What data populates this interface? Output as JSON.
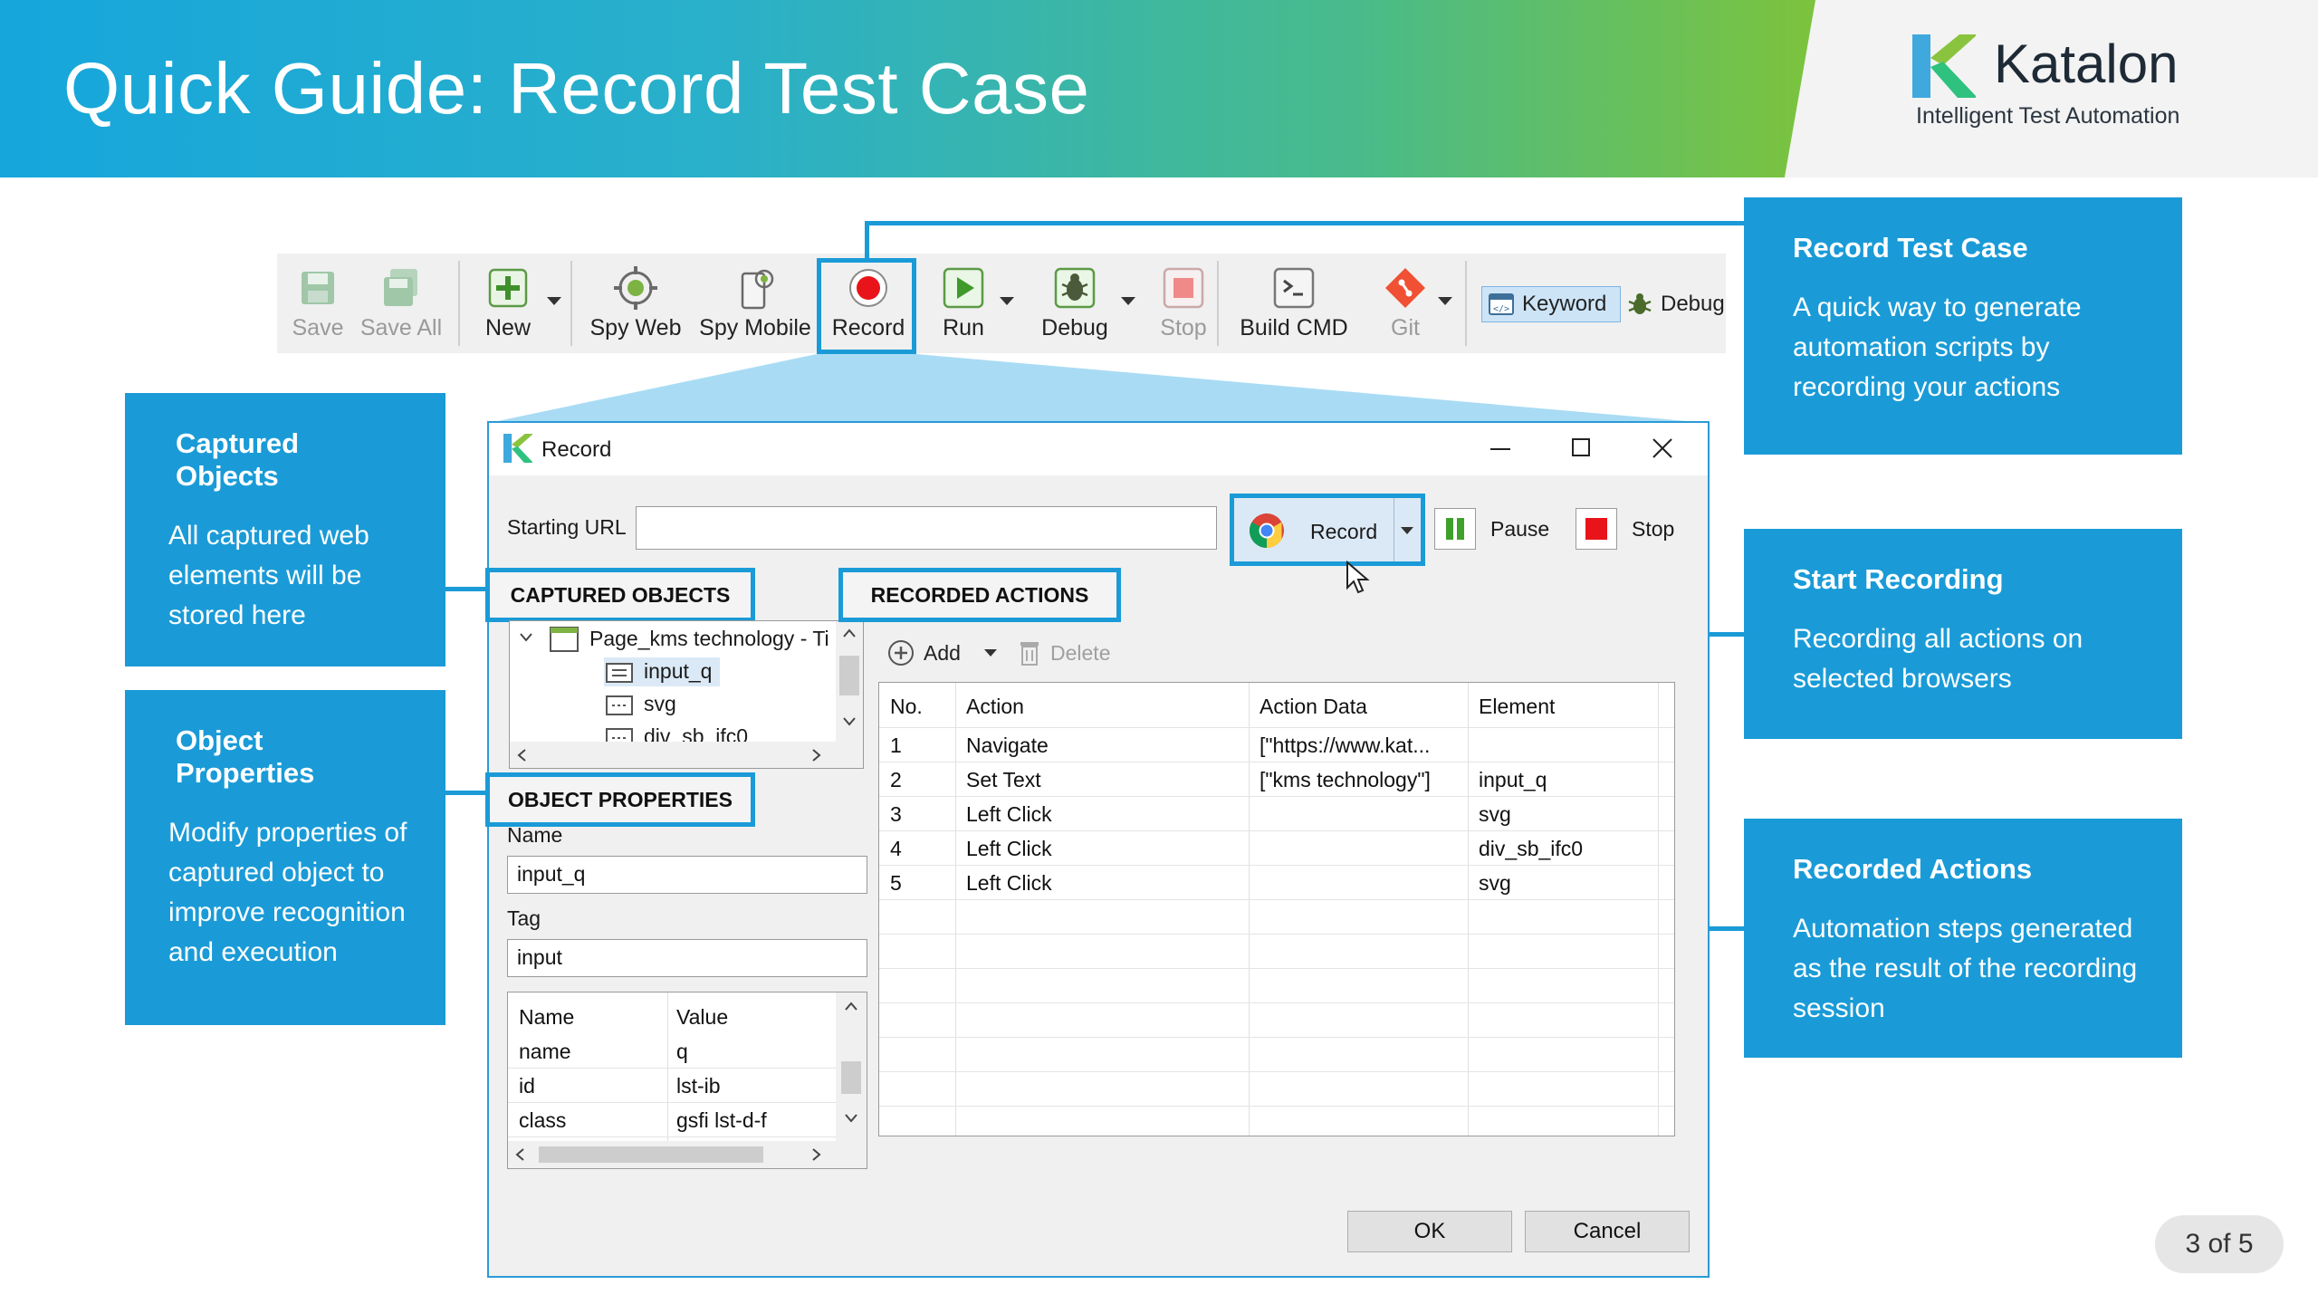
{
  "header": {
    "title": "Quick Guide: Record Test Case",
    "logo_name": "Katalon",
    "logo_tagline": "Intelligent Test Automation"
  },
  "toolbar": {
    "save": "Save",
    "save_all": "Save All",
    "new": "New",
    "spy_web": "Spy Web",
    "spy_mobile": "Spy Mobile",
    "record": "Record",
    "run": "Run",
    "debug": "Debug",
    "stop": "Stop",
    "build_cmd": "Build CMD",
    "git": "Git",
    "keyword": "Keyword",
    "debug_perspective": "Debug"
  },
  "callouts": {
    "record_test_case": {
      "title": "Record Test Case",
      "body": "A quick way to generate automation scripts by recording your actions"
    },
    "captured_objects": {
      "title": "Captured Objects",
      "body": "All captured web elements will be stored here"
    },
    "start_recording": {
      "title": "Start Recording",
      "body": "Recording all actions on selected browsers"
    },
    "object_properties": {
      "title": "Object Properties",
      "body": "Modify properties of captured object to improve recognition and execution"
    },
    "recorded_actions": {
      "title": "Recorded Actions",
      "body": "Automation steps generated as the result of the recording session"
    }
  },
  "dialog": {
    "title": "Record",
    "starting_url_label": "Starting URL",
    "starting_url_value": "",
    "record_button": "Record",
    "pause_button": "Pause",
    "stop_button": "Stop",
    "captured_objects_header": "CAPTURED OBJECTS",
    "object_properties_header": "OBJECT PROPERTIES",
    "recorded_actions_header": "RECORDED ACTIONS",
    "tree": {
      "page": "Page_kms technology - Ti",
      "items": [
        "input_q",
        "svg",
        "div_sb_ifc0"
      ]
    },
    "props": {
      "name_label": "Name",
      "name_value": "input_q",
      "tag_label": "Tag",
      "tag_value": "input",
      "columns": [
        "Name",
        "Value"
      ],
      "rows": [
        [
          "name",
          "q"
        ],
        [
          "id",
          "lst-ib"
        ],
        [
          "class",
          "gsfi lst-d-f"
        ]
      ]
    },
    "actions": {
      "add": "Add",
      "delete": "Delete",
      "columns": [
        "No.",
        "Action",
        "Action Data",
        "Element"
      ],
      "rows": [
        [
          "1",
          "Navigate",
          "[\"https://www.kat...",
          ""
        ],
        [
          "2",
          "Set Text",
          "[\"kms technology\"]",
          "input_q"
        ],
        [
          "3",
          "Left Click",
          "",
          "svg"
        ],
        [
          "4",
          "Left Click",
          "",
          "div_sb_ifc0"
        ],
        [
          "5",
          "Left Click",
          "",
          "svg"
        ]
      ]
    },
    "ok": "OK",
    "cancel": "Cancel"
  },
  "page_indicator": "3 of 5",
  "colors": {
    "accent": "#1a9bd7",
    "banner_start": "#16a6dc",
    "banner_end": "#7cc33d",
    "record_red": "#e8141a",
    "run_green": "#4caf50"
  }
}
